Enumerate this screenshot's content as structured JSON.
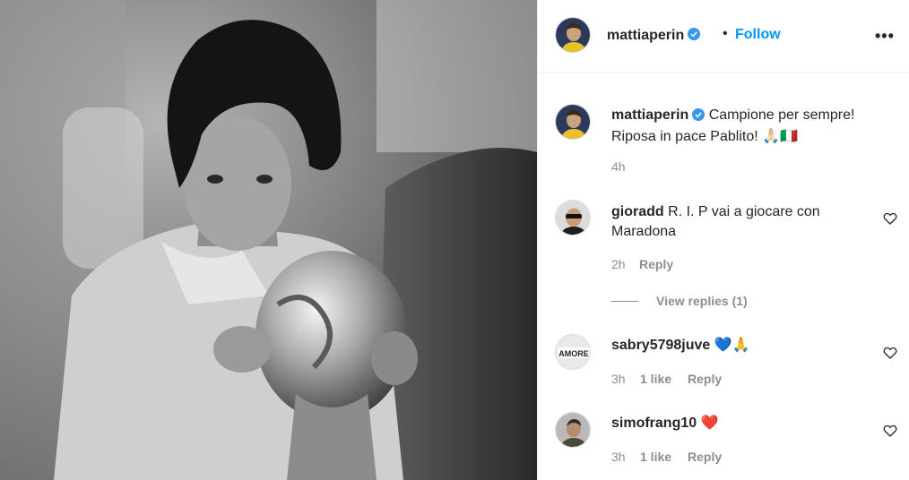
{
  "post": {
    "author": "mattiaperin",
    "follow_label": "Follow",
    "separator": "•",
    "more_label": "•••",
    "caption": {
      "username": "mattiaperin",
      "text_line1": "Campione per sempre!",
      "text_line2": "Riposa in pace Pablito! 🙏🏻🇮🇹",
      "time": "4h"
    }
  },
  "comments": [
    {
      "username": "gioradd",
      "text_line1": "R. I. P vai a giocare con",
      "text_line2": "Maradona",
      "time": "2h",
      "reply_label": "Reply",
      "view_replies": "View replies (1)"
    },
    {
      "username": "sabry5798juve",
      "text": "💙🙏",
      "time": "3h",
      "likes": "1 like",
      "reply_label": "Reply",
      "avatar_text": "AMORE"
    },
    {
      "username": "simofrang10",
      "text": "❤️",
      "time": "3h",
      "likes": "1 like",
      "reply_label": "Reply"
    }
  ],
  "colors": {
    "accent": "#0095f6",
    "verified": "#3897f0",
    "muted": "#8e8e8e",
    "text": "#262626"
  },
  "icons": [
    "verified-badge-icon",
    "more-options-icon",
    "heart-icon"
  ]
}
